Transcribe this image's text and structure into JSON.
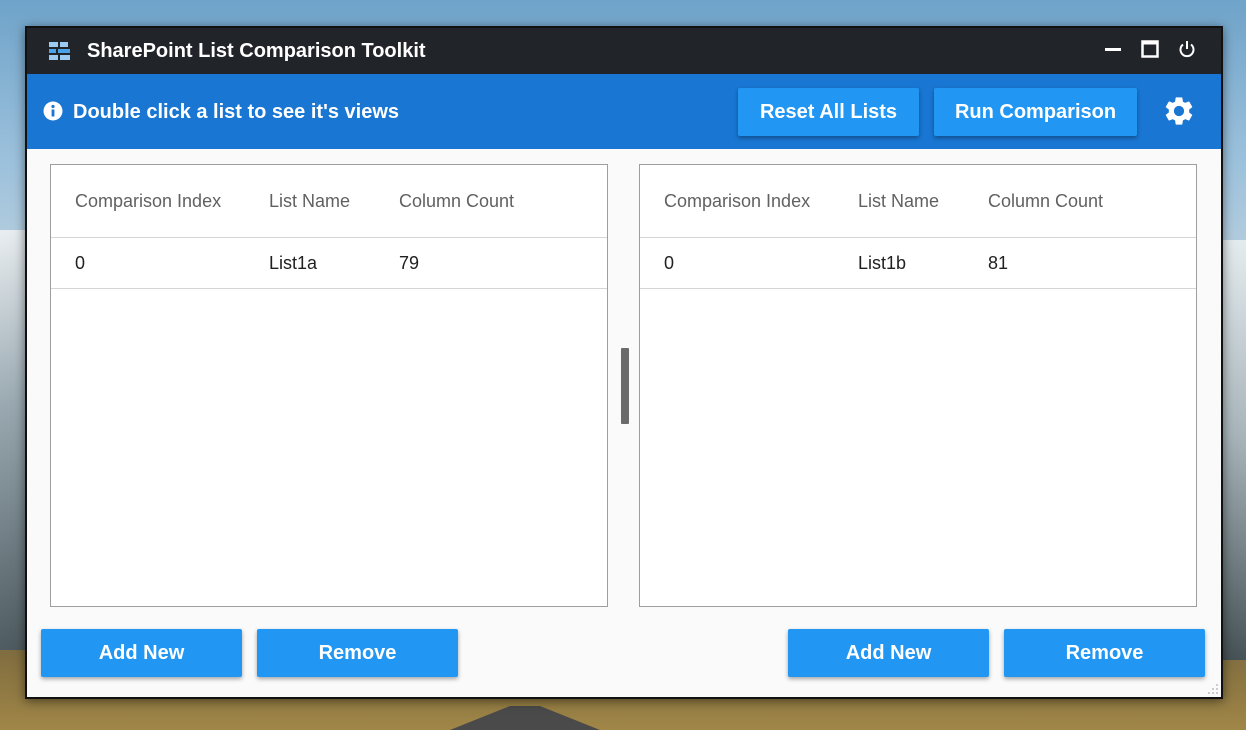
{
  "window": {
    "title": "SharePoint List Comparison Toolkit",
    "icons": {
      "app": "list-compare-icon",
      "minimize": "minimize-icon",
      "maximize": "maximize-icon",
      "power": "power-icon"
    }
  },
  "toolbar": {
    "info_text": "Double click a list to see it's views",
    "reset_label": "Reset All Lists",
    "run_label": "Run Comparison",
    "settings_icon": "gear-icon"
  },
  "left_panel": {
    "columns": [
      "Comparison Index",
      "List Name",
      "Column Count"
    ],
    "rows": [
      {
        "index": "0",
        "name": "List1a",
        "count": "79"
      }
    ],
    "add_label": "Add New",
    "remove_label": "Remove"
  },
  "right_panel": {
    "columns": [
      "Comparison Index",
      "List Name",
      "Column Count"
    ],
    "rows": [
      {
        "index": "0",
        "name": "List1b",
        "count": "81"
      }
    ],
    "add_label": "Add New",
    "remove_label": "Remove"
  },
  "colors": {
    "titlebar": "#212529",
    "toolbar": "#1976d2",
    "button": "#2196f3",
    "panel_border": "#9e9e9e"
  }
}
